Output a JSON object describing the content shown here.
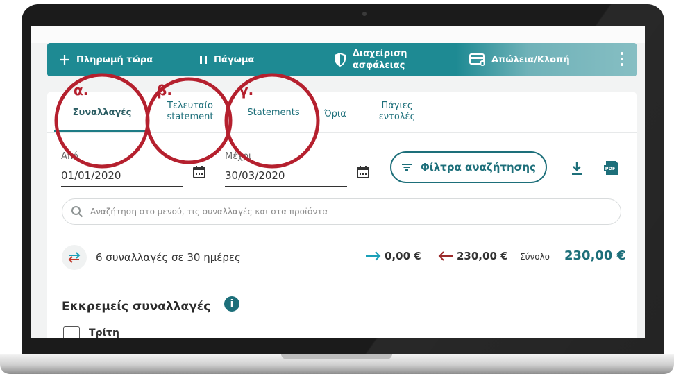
{
  "actions": [
    {
      "label": "Πληρωμή τώρα",
      "icon": "plus-icon"
    },
    {
      "label": "Πάγωμα",
      "icon": "pause-icon"
    },
    {
      "label_line1": "Διαχείριση",
      "label_line2": "ασφάλειας",
      "icon": "shield-icon"
    },
    {
      "label": "Απώλεια/Κλοπή",
      "icon": "card-lock-icon"
    }
  ],
  "tabs": [
    {
      "label": "Συναλλαγές",
      "active": true
    },
    {
      "label_line1": "Τελευταίο",
      "label_line2": "statement"
    },
    {
      "label": "Statements"
    },
    {
      "label": "Όρια"
    },
    {
      "label_line1": "Πάγιες",
      "label_line2": "εντολές"
    }
  ],
  "date_from": {
    "label": "Από",
    "value": "01/01/2020"
  },
  "date_to": {
    "label": "Μέχρι",
    "value": "30/03/2020"
  },
  "filter_button": "Φίλτρα αναζήτησης",
  "search_placeholder": "Αναζήτηση στο μενού, τις συναλλαγές και στα προϊόντα",
  "summary": {
    "text": "6 συναλλαγές σε 30 ημέρες",
    "incoming": "0,00 €",
    "outgoing": "230,00 €",
    "total_label": "Σύνολο",
    "total_value": "230,00 €"
  },
  "pending_title": "Εκκρεμείς συναλλαγές",
  "day_label": "Τρίτη",
  "annotations": [
    "α.",
    "β.",
    "γ."
  ],
  "colors": {
    "teal": "#1e8a93",
    "brand": "#1d6f7a",
    "annotation": "#b5202e",
    "incoming": "#1aa0b8",
    "outgoing": "#9b2a2a"
  }
}
